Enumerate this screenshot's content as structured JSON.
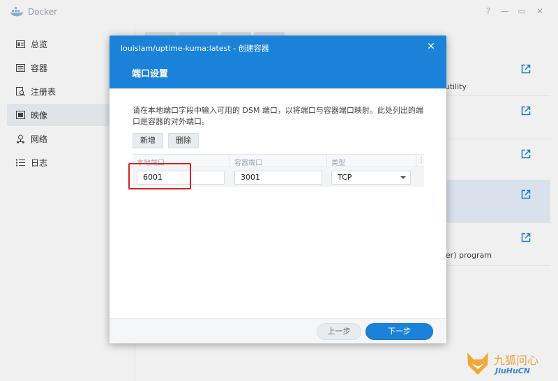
{
  "app": {
    "title": "Docker",
    "controls": [
      "?",
      "—",
      "▭",
      "✕"
    ]
  },
  "sidebar": {
    "items": [
      {
        "label": "总览",
        "icon": "overview-icon"
      },
      {
        "label": "容器",
        "icon": "container-icon"
      },
      {
        "label": "注册表",
        "icon": "registry-icon"
      },
      {
        "label": "映像",
        "icon": "image-icon",
        "active": true
      },
      {
        "label": "网络",
        "icon": "network-icon"
      },
      {
        "label": "日志",
        "icon": "log-icon"
      }
    ]
  },
  "background_list": {
    "row_texts": [
      "e utility",
      "rver) program"
    ]
  },
  "dialog": {
    "title": "louislam/uptime-kuma:latest - 创建容器",
    "step": "端口设置",
    "description": "请在本地端口字段中输入可用的 DSM 端口，以将端口与容器端口映射。此处列出的端口是容器的对外端口。",
    "add_label": "新增",
    "delete_label": "删除",
    "columns": [
      "本地端口",
      "容器端口",
      "类型"
    ],
    "row": {
      "local_port": "6001",
      "container_port": "3001",
      "type": "TCP"
    },
    "prev_label": "上一步",
    "next_label": "下一步"
  },
  "watermark": {
    "title": "九狐问心",
    "sub": "JiuHuCN"
  },
  "colors": {
    "accent": "#1b82d9",
    "highlight": "#e02020",
    "selected_row": "#e6f0fb"
  }
}
